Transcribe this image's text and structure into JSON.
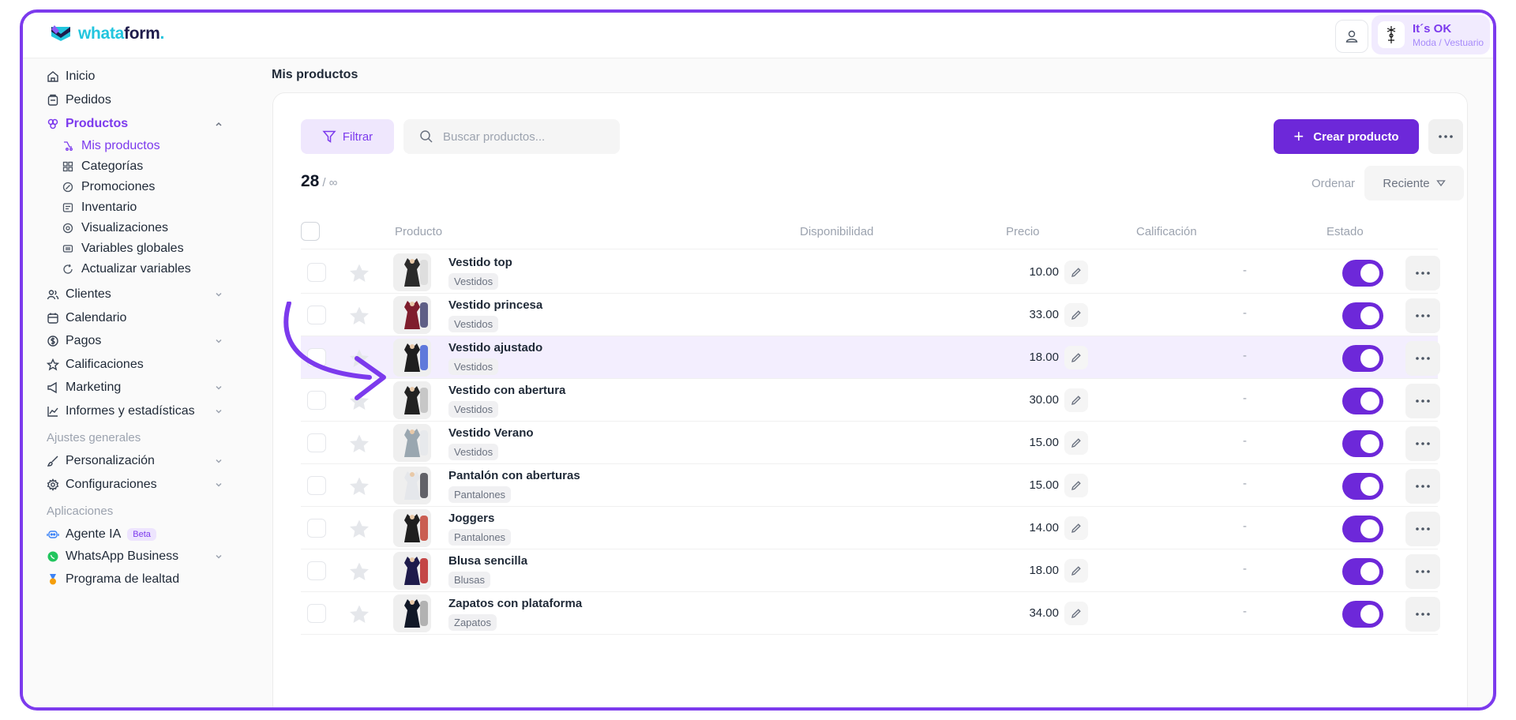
{
  "brand": {
    "name_a": "whata",
    "name_b": "form",
    "dot": "."
  },
  "account": {
    "name": "It´s OK",
    "subtitle": "Moda / Vestuario"
  },
  "sidebar": {
    "items": [
      {
        "label": "Inicio"
      },
      {
        "label": "Pedidos"
      },
      {
        "label": "Productos"
      },
      {
        "label": "Clientes"
      },
      {
        "label": "Calendario"
      },
      {
        "label": "Pagos"
      },
      {
        "label": "Calificaciones"
      },
      {
        "label": "Marketing"
      },
      {
        "label": "Informes y estadísticas"
      },
      {
        "label": "Personalización"
      },
      {
        "label": "Configuraciones"
      },
      {
        "label": "Agente IA"
      },
      {
        "label": "WhatsApp Business"
      },
      {
        "label": "Programa de lealtad"
      }
    ],
    "sub": [
      {
        "label": "Mis productos"
      },
      {
        "label": "Categorías"
      },
      {
        "label": "Promociones"
      },
      {
        "label": "Inventario"
      },
      {
        "label": "Visualizaciones"
      },
      {
        "label": "Variables globales"
      },
      {
        "label": "Actualizar variables"
      }
    ],
    "section_general": "Ajustes generales",
    "section_apps": "Aplicaciones",
    "beta": "Beta"
  },
  "page": {
    "title": "Mis productos"
  },
  "toolbar": {
    "filter": "Filtrar",
    "search_placeholder": "Buscar productos...",
    "create": "Crear producto"
  },
  "summary": {
    "count": "28",
    "limit": "/ ∞",
    "order_label": "Ordenar",
    "order_value": "Reciente"
  },
  "table": {
    "headers": {
      "product": "Producto",
      "availability": "Disponibilidad",
      "price": "Precio",
      "rating": "Calificación",
      "status": "Estado"
    },
    "rows": [
      {
        "name": "Vestido top",
        "category": "Vestidos",
        "price": "10.00",
        "rating": "-",
        "active": true
      },
      {
        "name": "Vestido princesa",
        "category": "Vestidos",
        "price": "33.00",
        "rating": "-",
        "active": true
      },
      {
        "name": "Vestido ajustado",
        "category": "Vestidos",
        "price": "18.00",
        "rating": "-",
        "active": true
      },
      {
        "name": "Vestido con abertura",
        "category": "Vestidos",
        "price": "30.00",
        "rating": "-",
        "active": true
      },
      {
        "name": "Vestido Verano",
        "category": "Vestidos",
        "price": "15.00",
        "rating": "-",
        "active": true
      },
      {
        "name": "Pantalón con aberturas",
        "category": "Pantalones",
        "price": "15.00",
        "rating": "-",
        "active": true
      },
      {
        "name": "Joggers",
        "category": "Pantalones",
        "price": "14.00",
        "rating": "-",
        "active": true
      },
      {
        "name": "Blusa sencilla",
        "category": "Blusas",
        "price": "18.00",
        "rating": "-",
        "active": true
      },
      {
        "name": "Zapatos con plataforma",
        "category": "Zapatos",
        "price": "34.00",
        "rating": "-",
        "active": true
      }
    ]
  },
  "colors": {
    "accent": "#6d28d9",
    "accent_light": "#f3eefe",
    "logo_cyan": "#22c5de",
    "logo_navy": "#1e1b4b"
  }
}
